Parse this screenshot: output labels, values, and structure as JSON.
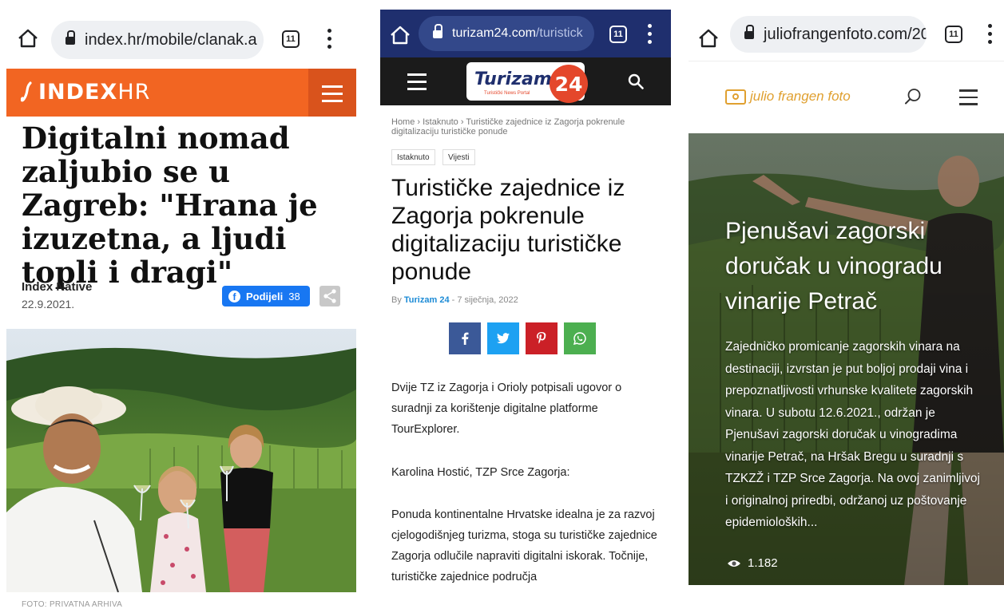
{
  "panel1": {
    "chrome": {
      "url": "index.hr/mobile/clanak.a",
      "tab_count": "11"
    },
    "logo": {
      "brand": "INDEX",
      "suffix": "HR"
    },
    "article": {
      "title": "Digitalni nomad zaljubio se u Zagreb: \"Hrana je izuzetna, a ljudi topli i dragi\"",
      "author": "Index Native",
      "date": "22.9.2021.",
      "share_label": "Podijeli",
      "share_count": "38",
      "photo_caption": "FOTO: PRIVATNA ARHIVA"
    }
  },
  "panel2": {
    "chrome": {
      "url_domain": "turizam24.com",
      "url_path": "/turistick",
      "tab_count": "11"
    },
    "logo": {
      "word": "Turizam",
      "sub": "Turistički News Portal",
      "number": "24"
    },
    "breadcrumb": "Home  ›  Istaknuto  ›  Turističke zajednice iz Zagorja pokrenule digitalizaciju turističke ponude",
    "tags": [
      "Istaknuto",
      "Vijesti"
    ],
    "article": {
      "title": "Turističke zajednice iz Zagorja pokrenule digitalizaciju turističke ponude",
      "by": "By",
      "author": "Turizam 24",
      "date": " - 7 siječnja, 2022",
      "paragraphs": [
        "Dvije TZ iz Zagorja i Orioly potpisali ugovor o suradnji za korištenje digitalne platforme TourExplorer.",
        "Karolina Hostić, TZP Srce Zagorja:",
        "Ponuda kontinentalne Hrvatske idealna je za razvoj cjelogodišnjeg turizma, stoga su turističke zajednice Zagorja odlučile napraviti digitalni iskorak. Točnije, turističke zajednice područja"
      ]
    },
    "share_buttons": [
      {
        "glyph": "f",
        "color": "#3b5998"
      },
      {
        "glyph": "t",
        "color": "#1da1f2"
      },
      {
        "glyph": "p",
        "color": "#cb2027"
      },
      {
        "glyph": "w",
        "color": "#4caf50"
      }
    ]
  },
  "panel3": {
    "chrome": {
      "url": "juliofrangenfoto.com/20",
      "tab_count": "11"
    },
    "logo": "julio frangen foto",
    "article": {
      "title": "Pjenušavi zagorski doručak u vinogradu vinarije Petrač",
      "excerpt": "Zajedničko promicanje zagorskih vinara na destinaciji, izvrstan je put boljoj prodaji vina i prepoznatljivosti vrhunske kvalitete zagorskih vinara. U subotu 12.6.2021., održan je Pjenušavi zagorski doručak u vinogradima vinarije Petrač, na Hršak Bregu u suradnji s TZKZŽ i TZP Srce Zagorja. Na ovoj zanimljivoj i originalnoj priredbi, održanoj uz poštovanje epidemioloških...",
      "views": "1.182"
    }
  }
}
